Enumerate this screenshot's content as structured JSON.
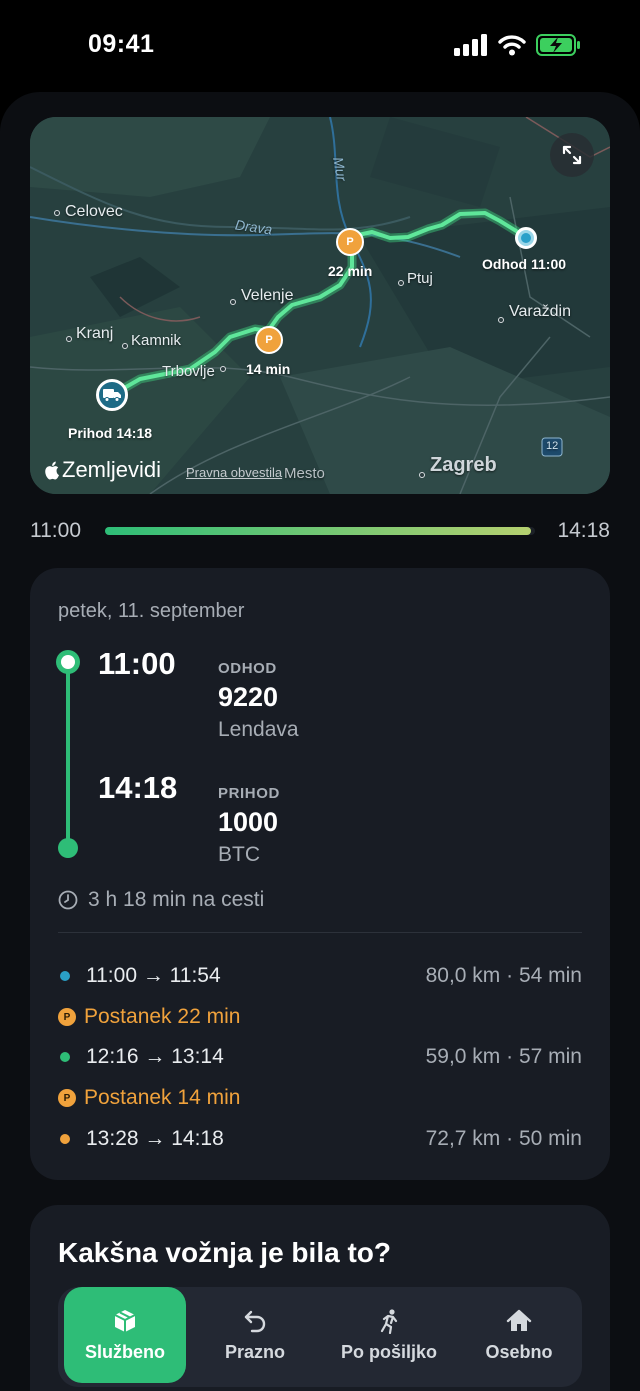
{
  "status_bar": {
    "time": "09:41"
  },
  "map": {
    "labels": {
      "celovec": "Celovec",
      "drava": "Drava",
      "mur": "Mur",
      "velenje": "Velenje",
      "kranj": "Kranj",
      "kamnik": "Kamnik",
      "trbovlje": "Trbovlje",
      "ptuj": "Ptuj",
      "varazdin": "Varaždin",
      "zagreb": "Zagreb",
      "novo_mesto": "Mesto",
      "road_number": "12"
    },
    "pins": {
      "stop1_duration": "22 min",
      "stop2_duration": "14 min",
      "start_label": "Odhod 11:00",
      "end_label": "Prihod 14:18",
      "parking_glyph": "P"
    },
    "attribution": "Zemljevidi",
    "legal": "Pravna obvestila"
  },
  "progress": {
    "start": "11:00",
    "end": "14:18",
    "fraction": 0.99
  },
  "trip": {
    "date": "petek, 11. september",
    "departure": {
      "time": "11:00",
      "kind": "ODHOD",
      "code": "9220",
      "place": "Lendava"
    },
    "arrival": {
      "time": "14:18",
      "kind": "PRIHOD",
      "code": "1000",
      "place": "BTC"
    },
    "duration": "3 h 18 min na cesti",
    "segments": [
      {
        "times": "11:00 → 11:54",
        "meta": "80,0 km · 54 min",
        "color": "#2a9fc6"
      },
      {
        "stop": "Postanek 22 min"
      },
      {
        "times": "12:16 → 13:14",
        "meta": "59,0 km · 57 min",
        "color": "#2ebd77"
      },
      {
        "stop": "Postanek 14 min"
      },
      {
        "times": "13:28 → 14:18",
        "meta": "72,7 km · 50 min",
        "color": "#f0a23c"
      }
    ]
  },
  "ride_type": {
    "question": "Kakšna vožnja je bila to?",
    "options": [
      {
        "label": "Službeno",
        "icon": "box-icon",
        "active": true
      },
      {
        "label": "Prazno",
        "icon": "return-arrow-icon",
        "active": false
      },
      {
        "label": "Po pošiljko",
        "icon": "running-person-icon",
        "active": false
      },
      {
        "label": "Osebno",
        "icon": "house-icon",
        "active": false
      }
    ]
  },
  "colors": {
    "accent": "#2ebd77",
    "stop": "#f0a23c",
    "first_segment": "#2a9fc6"
  }
}
